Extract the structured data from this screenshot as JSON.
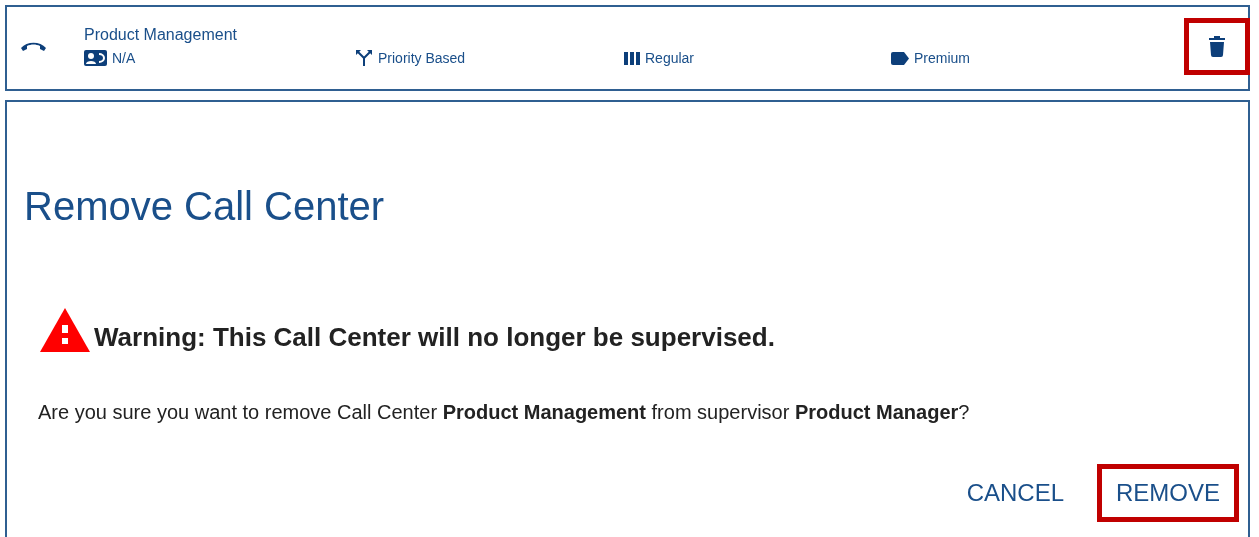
{
  "row": {
    "name": "Product Management",
    "details": [
      {
        "kind": "contact",
        "text": "N/A"
      },
      {
        "kind": "routing",
        "text": "Priority Based"
      },
      {
        "kind": "queue",
        "text": "Regular"
      },
      {
        "kind": "tier",
        "text": "Premium"
      }
    ],
    "delete_highlighted": true
  },
  "dialog": {
    "title": "Remove Call Center",
    "warning": "Warning: This Call Center will no longer be supervised.",
    "message": "Are you sure you want to remove Call Center **Product Management** from supervisor **Product Manager**?",
    "buttons": [
      {
        "label": "CANCEL",
        "highlighted": false
      },
      {
        "label": "REMOVE",
        "highlighted": true
      }
    ]
  }
}
